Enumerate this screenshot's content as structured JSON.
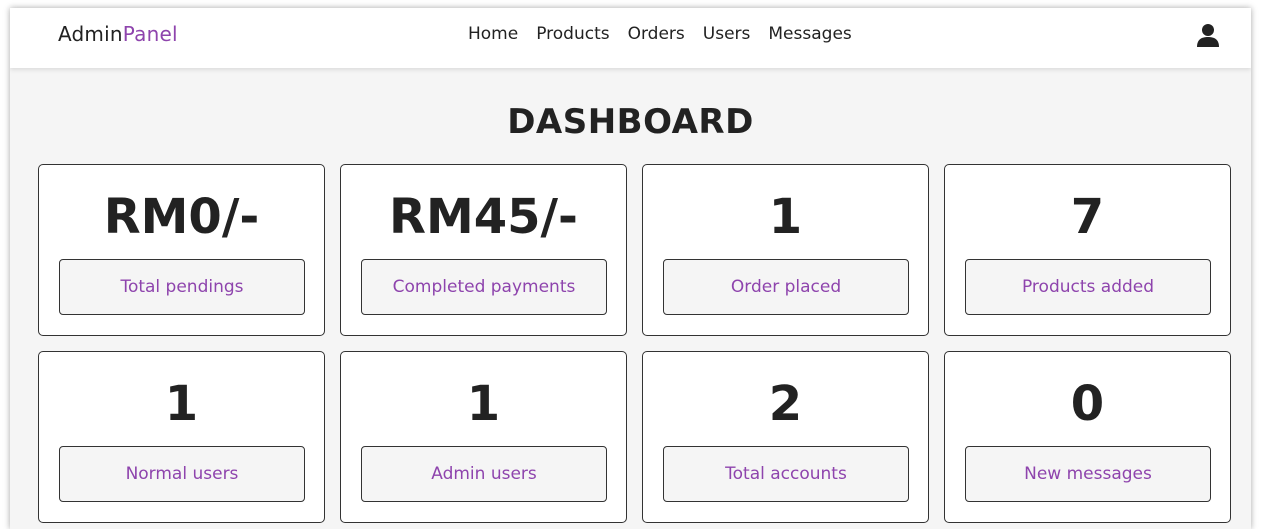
{
  "header": {
    "logo_main": "Admin",
    "logo_accent": "Panel",
    "nav": [
      "Home",
      "Products",
      "Orders",
      "Users",
      "Messages"
    ],
    "user_icon": "user-icon"
  },
  "page_title": "DASHBOARD",
  "colors": {
    "accent": "#8e44ad",
    "background": "#f5f5f5",
    "text": "#222222"
  },
  "cards": [
    {
      "value": "RM0/-",
      "label": "Total pendings"
    },
    {
      "value": "RM45/-",
      "label": "Completed payments"
    },
    {
      "value": "1",
      "label": "Order placed"
    },
    {
      "value": "7",
      "label": "Products added"
    },
    {
      "value": "1",
      "label": "Normal users"
    },
    {
      "value": "1",
      "label": "Admin users"
    },
    {
      "value": "2",
      "label": "Total accounts"
    },
    {
      "value": "0",
      "label": "New messages"
    }
  ]
}
